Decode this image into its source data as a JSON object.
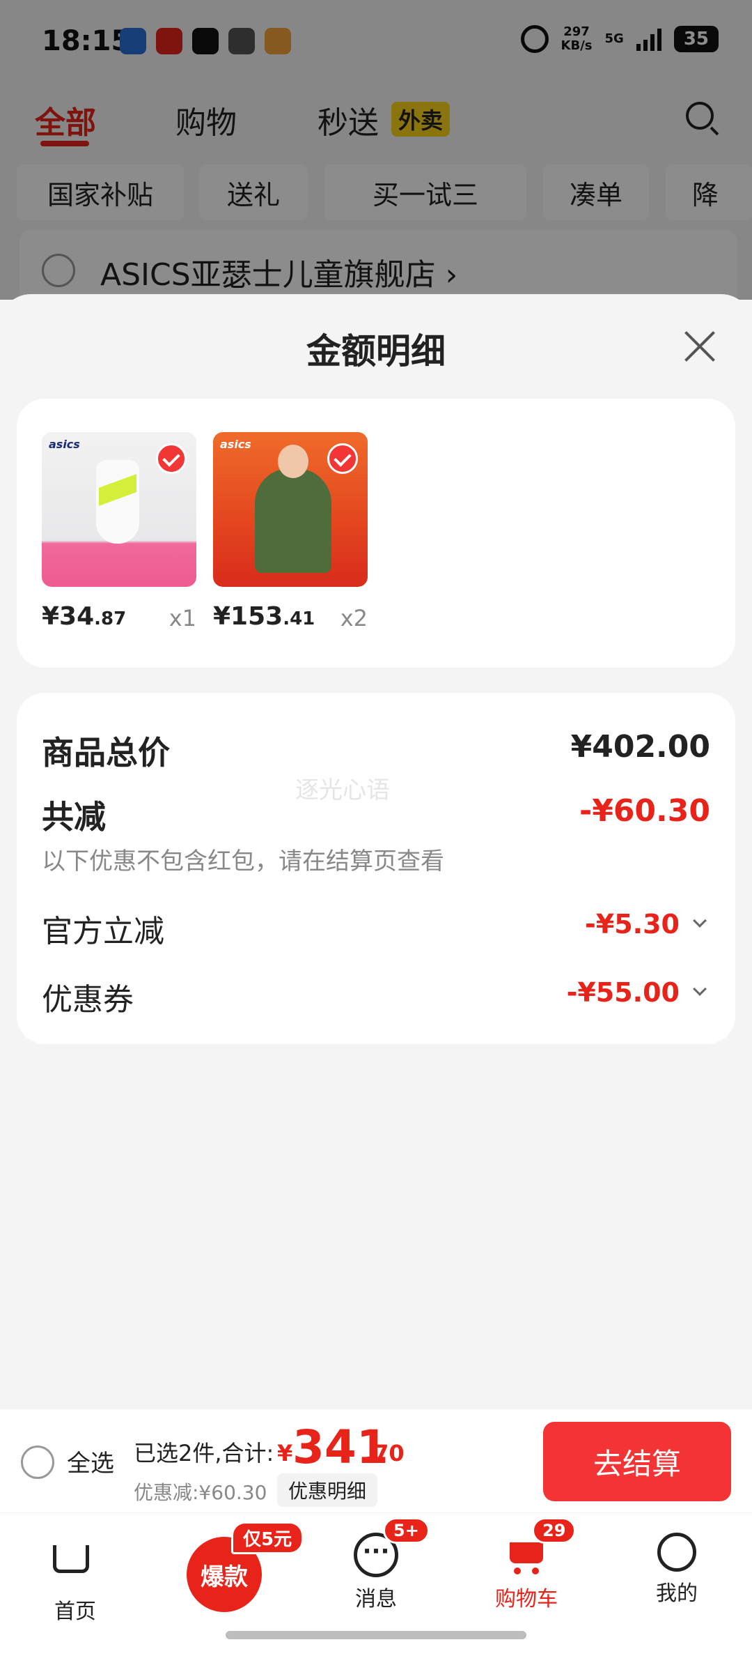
{
  "status_bar": {
    "time": "18:15",
    "net_speed_value": "297",
    "net_speed_unit": "KB/s",
    "network": "5G",
    "battery": "35"
  },
  "top_tabs": {
    "all": "全部",
    "shopping": "购物",
    "express": "秒送",
    "waimai": "外卖"
  },
  "chips": [
    "国家补贴",
    "送礼",
    "买一试三",
    "凑单",
    "降"
  ],
  "store": {
    "name": "ASICS亚瑟士儿童旗舰店 ›"
  },
  "sheet": {
    "title": "金额明细",
    "products": [
      {
        "price_int": "¥34",
        "price_dec": ".87",
        "qty": "x1",
        "brand": "asics"
      },
      {
        "price_int": "¥153",
        "price_dec": ".41",
        "qty": "x2",
        "brand": "asics"
      }
    ],
    "details": {
      "total_label": "商品总价",
      "total_value": "¥402.00",
      "reduce_label": "共减",
      "reduce_value": "-¥60.30",
      "note": "以下优惠不包含红包，请在结算页查看",
      "official_label": "官方立减",
      "official_value": "-¥5.30",
      "coupon_label": "优惠券",
      "coupon_value": "-¥55.00",
      "watermark": "逐光心语"
    }
  },
  "checkout": {
    "select_all": "全选",
    "summary": "已选2件,合计:",
    "currency": "¥",
    "total_int": "341",
    "total_dec": ".70",
    "saved": "优惠减:¥60.30",
    "detail_button": "优惠明细",
    "pay_button": "去结算"
  },
  "nav": {
    "home": "首页",
    "hot": "爆款",
    "hot_badge": "仅5元",
    "messages": "消息",
    "messages_badge": "5+",
    "cart": "购物车",
    "cart_badge": "29",
    "me": "我的"
  },
  "colors": {
    "accent": "#e8231a",
    "button": "#f43434",
    "waimai": "#fbd41b"
  }
}
